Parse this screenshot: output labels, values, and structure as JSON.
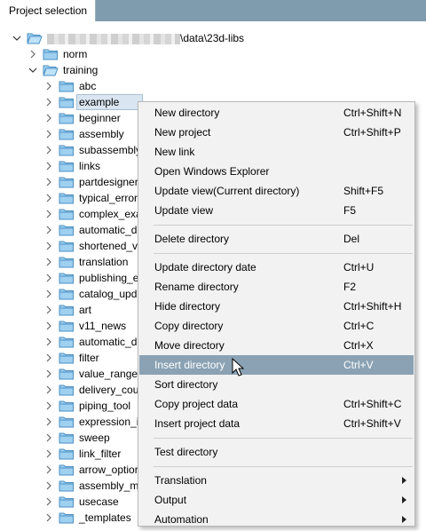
{
  "tab": {
    "title": "Project selection"
  },
  "root": {
    "path_suffix": "\\data\\23d-libs"
  },
  "tree": [
    {
      "label": "norm",
      "level": 1,
      "expanded": false
    },
    {
      "label": "training",
      "level": 1,
      "expanded": true
    },
    {
      "label": "abc",
      "level": 2
    },
    {
      "label": "example",
      "level": 2,
      "selected": true
    },
    {
      "label": "beginner",
      "level": 2
    },
    {
      "label": "assembly",
      "level": 2
    },
    {
      "label": "subassembly",
      "level": 2
    },
    {
      "label": "links",
      "level": 2
    },
    {
      "label": "partdesigner",
      "level": 2
    },
    {
      "label": "typical_error",
      "level": 2
    },
    {
      "label": "complex_exa",
      "level": 2
    },
    {
      "label": "automatic_d",
      "level": 2
    },
    {
      "label": "shortened_vi",
      "level": 2
    },
    {
      "label": "translation",
      "level": 2
    },
    {
      "label": "publishing_e",
      "level": 2
    },
    {
      "label": "catalog_upd",
      "level": 2
    },
    {
      "label": "art",
      "level": 2
    },
    {
      "label": "v11_news",
      "level": 2
    },
    {
      "label": "automatic_d",
      "level": 2
    },
    {
      "label": "filter",
      "level": 2
    },
    {
      "label": "value_ranges",
      "level": 2
    },
    {
      "label": "delivery_cou",
      "level": 2
    },
    {
      "label": "piping_tool",
      "level": 2
    },
    {
      "label": "expression_ir",
      "level": 2
    },
    {
      "label": "sweep",
      "level": 2
    },
    {
      "label": "link_filter",
      "level": 2
    },
    {
      "label": "arrow_optior",
      "level": 2
    },
    {
      "label": "assembly_m",
      "level": 2
    },
    {
      "label": "usecase",
      "level": 2
    },
    {
      "label": "_templates",
      "level": 2
    }
  ],
  "menu": {
    "groups": [
      [
        {
          "label": "New directory",
          "shortcut": "Ctrl+Shift+N"
        },
        {
          "label": "New project",
          "shortcut": "Ctrl+Shift+P"
        },
        {
          "label": "New link",
          "shortcut": ""
        },
        {
          "label": "Open Windows Explorer",
          "shortcut": ""
        },
        {
          "label": "Update view(Current directory)",
          "shortcut": "Shift+F5"
        },
        {
          "label": "Update view",
          "shortcut": "F5"
        }
      ],
      [
        {
          "label": "Delete directory",
          "shortcut": "Del"
        }
      ],
      [
        {
          "label": "Update directory date",
          "shortcut": "Ctrl+U"
        },
        {
          "label": "Rename directory",
          "shortcut": "F2"
        },
        {
          "label": "Hide directory",
          "shortcut": "Ctrl+Shift+H"
        },
        {
          "label": "Copy directory",
          "shortcut": "Ctrl+C"
        },
        {
          "label": "Move directory",
          "shortcut": "Ctrl+X"
        },
        {
          "label": "Insert directory",
          "shortcut": "Ctrl+V",
          "hover": true
        },
        {
          "label": "Sort directory",
          "shortcut": ""
        },
        {
          "label": "Copy project data",
          "shortcut": "Ctrl+Shift+C"
        },
        {
          "label": "Insert project data",
          "shortcut": "Ctrl+Shift+V"
        }
      ],
      [
        {
          "label": "Test directory",
          "shortcut": ""
        }
      ],
      [
        {
          "label": "Translation",
          "shortcut": "",
          "submenu": true
        },
        {
          "label": "Output",
          "shortcut": "",
          "submenu": true
        },
        {
          "label": "Automation",
          "shortcut": "",
          "submenu": true
        }
      ]
    ]
  },
  "colors": {
    "titlebar": "#7f9cae",
    "menu_hover": "#8aa2b3",
    "folder": "#9fd0f0",
    "folder_edge": "#4a8fc4"
  }
}
